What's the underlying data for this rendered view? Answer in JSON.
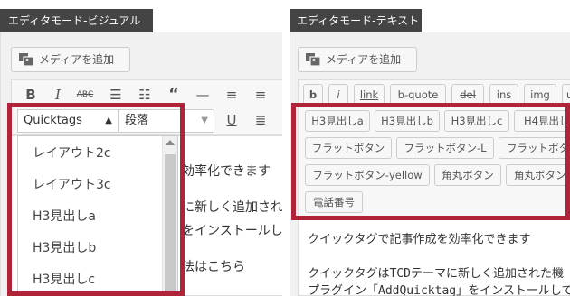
{
  "left_panel": {
    "title": "エディタモード-ビジュアル",
    "media_button": "メディアを追加",
    "quicktags_select": "Quicktags",
    "format_select": "段落",
    "dropdown_items": [
      "レイアウト2c",
      "レイアウト3c",
      "H3見出しa",
      "H3見出しb",
      "H3見出しc"
    ],
    "content_lines": [
      "効率化できます",
      "に新しく追加され",
      "をインストールし",
      "法はこちら"
    ]
  },
  "right_panel": {
    "title": "エディタモード-テキスト",
    "media_button": "メディアを追加",
    "format_buttons": [
      "b",
      "i",
      "link",
      "b-quote",
      "del",
      "ins",
      "img",
      "u"
    ],
    "quicktag_rows": [
      [
        "H3見出しa",
        "H3見出しb",
        "H3見出しc",
        "H4見出し"
      ],
      [
        "フラットボタン",
        "フラットボタン-L",
        "フラットボタ"
      ],
      [
        "フラットボタン-yellow",
        "角丸ボタン",
        "角丸ボタン"
      ],
      [
        "電話番号"
      ]
    ],
    "content_lines": [
      "クイックタグで記事作成を効率化できます",
      "クイックタグはTCDテーマに新しく追加された機",
      "プラグイン「AddQuicktag」をインストールして"
    ]
  },
  "colors": {
    "highlight": "#b0243a",
    "titlebar": "#444444"
  }
}
